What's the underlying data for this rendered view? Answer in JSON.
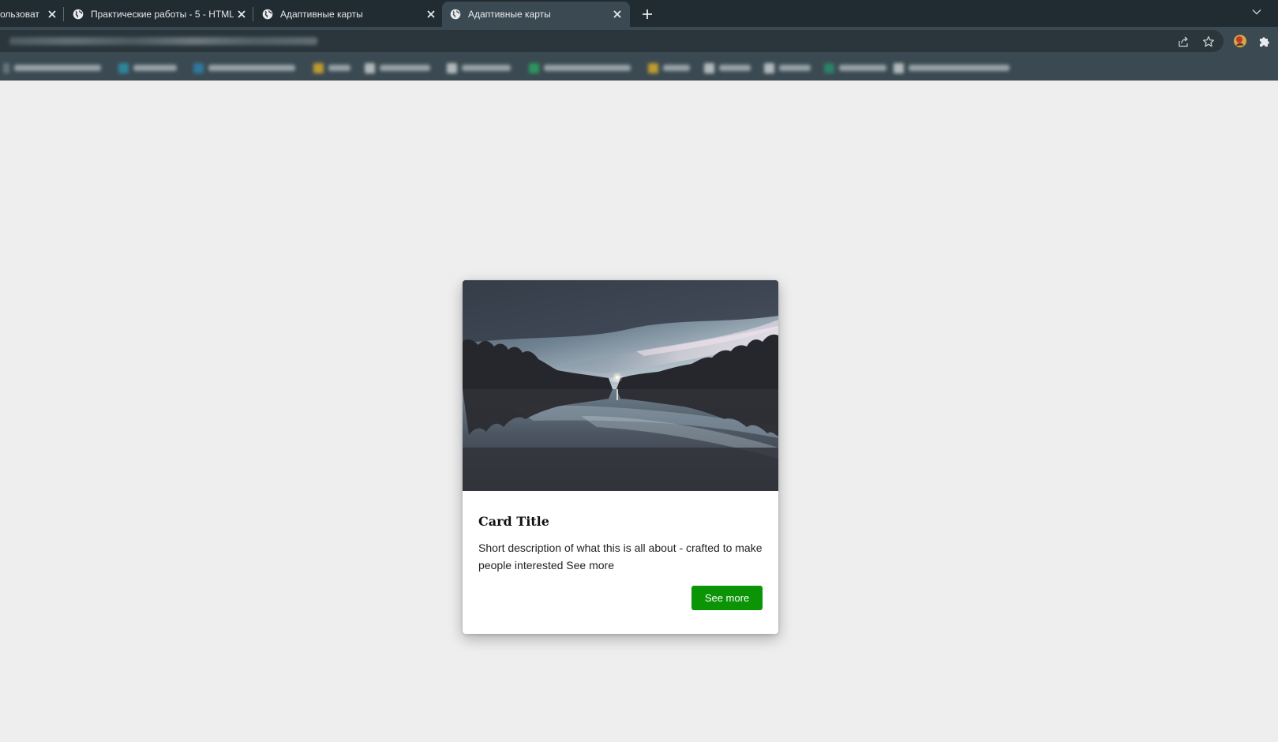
{
  "browser": {
    "tabs": [
      {
        "title": "ользоват",
        "active": false
      },
      {
        "title": "Практические работы - 5 - HTML",
        "active": false
      },
      {
        "title": "Адаптивные карты",
        "active": false
      },
      {
        "title": "Адаптивные карты",
        "active": true
      }
    ],
    "icons": {
      "share": "share-icon",
      "bookmark": "star-icon",
      "profile": "profile-avatar-icon",
      "extensions": "puzzle-icon",
      "new_tab": "plus-icon",
      "tab_search": "chevron-down-icon",
      "tab_favicon": "globe-icon",
      "tab_close": "close-icon"
    },
    "colors": {
      "tabstrip": "#202b32",
      "toolbar": "#3b4a52",
      "omnibox": "#2a363c"
    }
  },
  "card": {
    "title": "Card Title",
    "description": "Short description of what this is all about - crafted to make people interested See more",
    "button_label": "See more",
    "image": "night lake landscape with tree silhouettes reflected in water",
    "colors": {
      "button": "#0b9406",
      "page_background": "#eeeeee"
    }
  }
}
